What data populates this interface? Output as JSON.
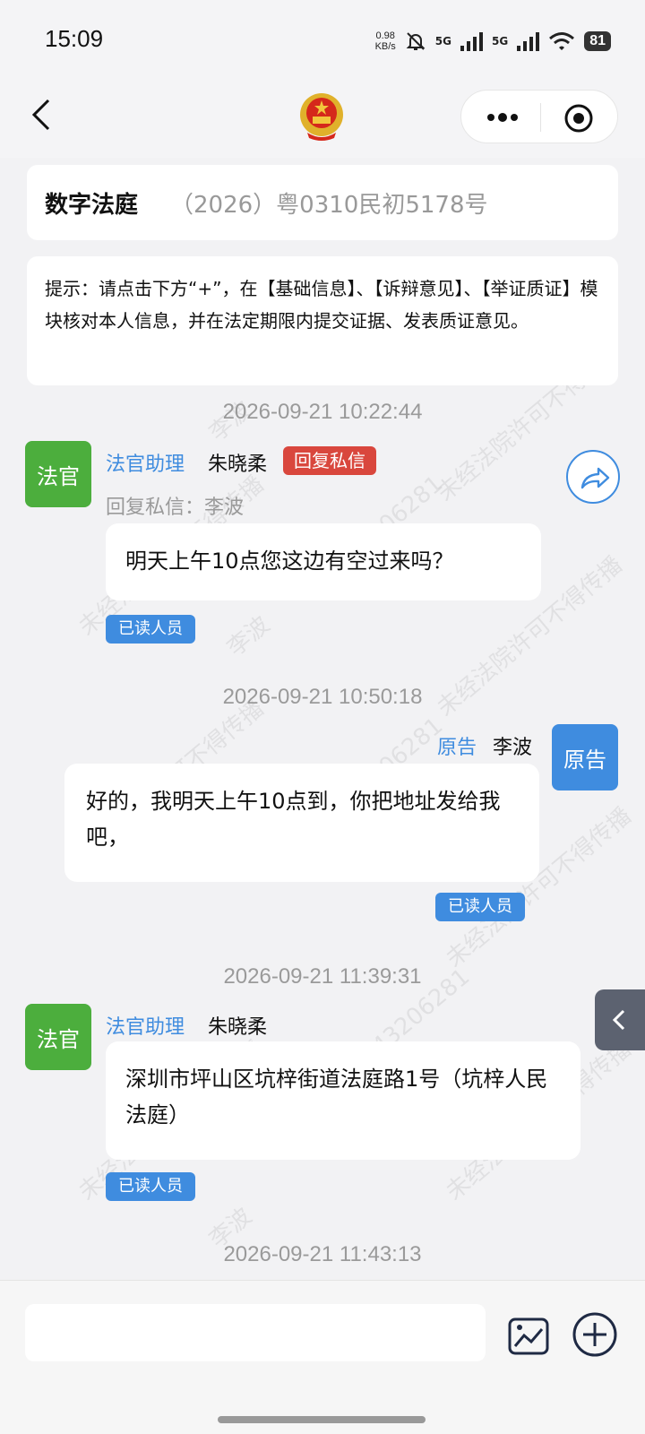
{
  "status_bar": {
    "time": "15:09",
    "net_speed_value": "0.98",
    "net_speed_unit": "KB/s",
    "signal_1": "5G",
    "signal_2": "5G",
    "battery": "81",
    "icons": [
      "mute-bell-icon",
      "signal-icon",
      "wifi-icon",
      "battery-icon"
    ]
  },
  "nav": {
    "icons": [
      "back-icon",
      "national-emblem-icon",
      "more-dots-icon",
      "target-icon"
    ]
  },
  "header": {
    "title": "数字法庭",
    "case_number": "（2026）粤0310民初5178号"
  },
  "tip": {
    "text": "提示：请点击下方“+”，在【基础信息】、【诉辩意见】、【举证质证】模块核对本人信息，并在法定期限内提交证据、发表质证意见。"
  },
  "watermark": {
    "text": "未经法院许可不得传播",
    "name": "李波",
    "number": "17343206281"
  },
  "messages": [
    {
      "timestamp": "2026-09-21 10:22:44",
      "avatar": "法官",
      "role": "法官助理",
      "name": "朱晓柔",
      "badge": "回复私信",
      "reply_to": "回复私信：李波",
      "text": "明天上午10点您这边有空过来吗？",
      "read": "已读人员"
    },
    {
      "timestamp": "2026-09-21 10:50:18",
      "avatar": "原告",
      "role": "原告",
      "name": "李波",
      "text": "好的，我明天上午10点到，你把地址发给我吧，",
      "read": "已读人员"
    },
    {
      "timestamp": "2026-09-21 11:39:31",
      "avatar": "法官",
      "role": "法官助理",
      "name": "朱晓柔",
      "text": "深圳市坪山区坑梓街道法庭路1号（坑梓人民法庭）",
      "read": "已读人员"
    },
    {
      "timestamp": "2026-09-21 11:43:13"
    }
  ],
  "input": {
    "placeholder": "",
    "icons": [
      "image-icon",
      "plus-circle-icon"
    ]
  },
  "colors": {
    "accent_blue": "#3f8cdf",
    "judge_green": "#4cae3d",
    "badge_red": "#d9473d",
    "background": "#f2f2f4"
  }
}
